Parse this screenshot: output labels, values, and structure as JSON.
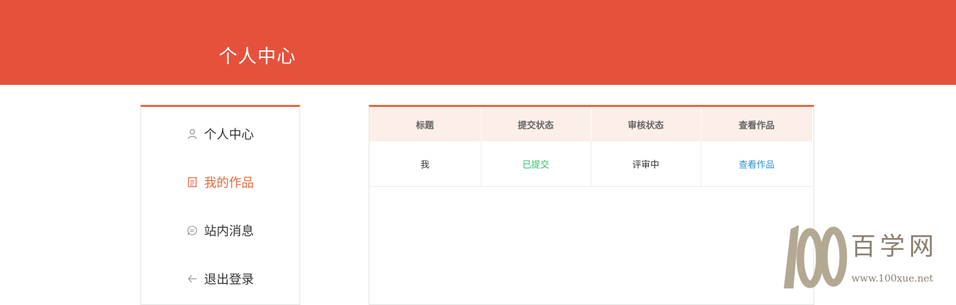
{
  "header": {
    "title": "个人中心",
    "bg_color": "#e6513b"
  },
  "sidebar": {
    "accent_color": "#e8693f",
    "items": [
      {
        "label": "个人中心",
        "icon": "user-icon",
        "active": false
      },
      {
        "label": "我的作品",
        "icon": "document-icon",
        "active": true
      },
      {
        "label": "站内消息",
        "icon": "message-icon",
        "active": false
      },
      {
        "label": "退出登录",
        "icon": "arrow-left-icon",
        "active": false
      }
    ]
  },
  "table": {
    "columns": [
      "标题",
      "提交状态",
      "审核状态",
      "查看作品"
    ],
    "rows": [
      {
        "title": "我",
        "submit_status": "已提交",
        "review_status": "评审中",
        "view": "查看作品"
      }
    ]
  },
  "watermark": {
    "logo": "100",
    "text": "百学网",
    "url": "www.100xue.net"
  }
}
